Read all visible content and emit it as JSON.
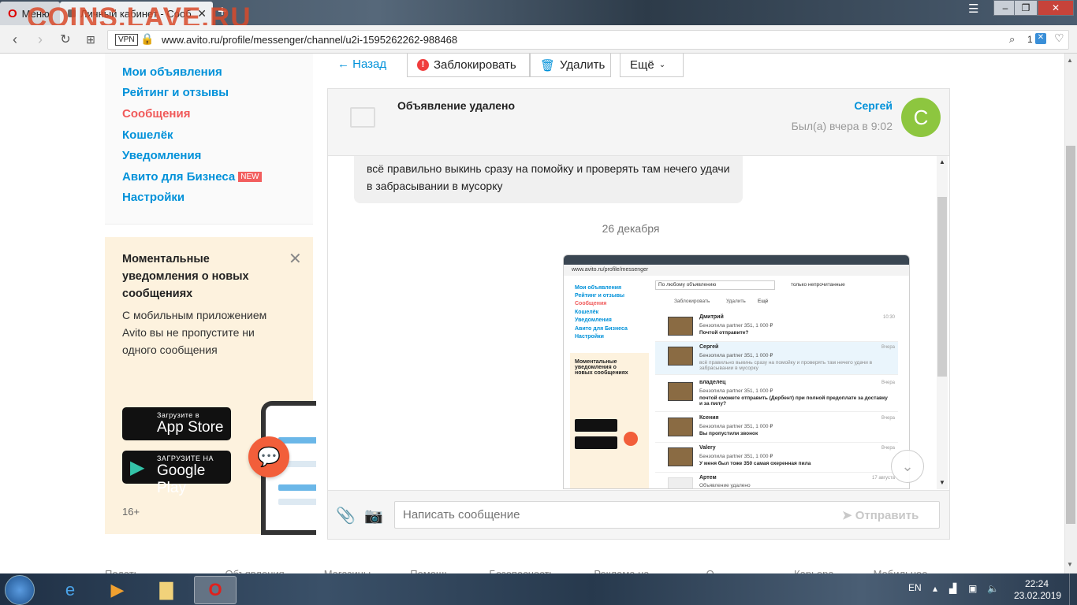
{
  "browser": {
    "tabs": [
      {
        "label": "Меню"
      },
      {
        "label": "Личный кабинет - Сооб"
      }
    ],
    "watermark": "COINS.LAVE.RU",
    "vpn": "VPN",
    "url": "www.avito.ru/profile/messenger/channel/u2i-1595262262-988468",
    "tracker_count": "1"
  },
  "sidebar": {
    "items": [
      {
        "label": "Мои объявления"
      },
      {
        "label": "Рейтинг и отзывы"
      },
      {
        "label": "Сообщения"
      },
      {
        "label": "Кошелёк"
      },
      {
        "label": "Уведомления"
      },
      {
        "label": "Авито для Бизнеса"
      },
      {
        "label": "Настройки"
      }
    ],
    "new_badge": "NEW",
    "active_color": "#f05a5a",
    "link_color": "#0091d9"
  },
  "promo": {
    "title": "Моментальные уведомления о новых сообщениях",
    "text": "С мобильным приложением Avito вы не пропустите ни одного сообщения",
    "appstore_small": "Загрузите в",
    "appstore_big": "App Store",
    "googleplay_small": "ЗАГРУЗИТЕ НА",
    "googleplay_big": "Google Play",
    "age": "16+"
  },
  "toolbar": {
    "back": "← Назад",
    "block": "Заблокировать",
    "delete": "Удалить",
    "more": "Ещё"
  },
  "chat": {
    "item_title": "Объявление удалено",
    "user_name": "Сергей",
    "avatar_letter": "С",
    "last_seen": "Был(а) вчера в 9:02",
    "message": "всё правильно выкинь сразу на помойку и проверять там нечего удачи в забрасывании в мусорку",
    "date_separator": "26 декабря",
    "input_placeholder": "Написать сообщение",
    "send": "Отправить"
  },
  "screenshot_preview": {
    "url": "www.avito.ru/profile/messenger",
    "filter": "По любому объявлению",
    "unread_only": "только непрочитанные",
    "block": "Заблокировать",
    "delete": "Удалить",
    "more": "Ещё",
    "sidebar": [
      "Мои объявления",
      "Рейтинг и отзывы",
      "Сообщения",
      "Кошелёк",
      "Уведомления",
      "Авито для Бизнеса",
      "Настройки"
    ],
    "promo": "Моментальные уведомления о новых сообщениях",
    "rows": [
      {
        "name": "Дмитрий",
        "line1": "Бензопила partner 351, 1 000 ₽",
        "line2": "Почтой отправите?",
        "time": "10:30"
      },
      {
        "name": "Сергей",
        "line1": "Бензопила partner 351, 1 000 ₽",
        "line2": "всё правильно выкинь сразу на помойку и проверять там нечего удачи в забрасывании в мусорку",
        "time": "Вчера"
      },
      {
        "name": "владелец",
        "line1": "Бензопила partner 351, 1 000 ₽",
        "line2": "почтой сможете отправить (Дербент) при полной предоплате за доставку и за пилу?",
        "time": "Вчера"
      },
      {
        "name": "Ксения",
        "line1": "Бензопила partner 351, 1 000 ₽",
        "line2": "Вы пропустили звонок",
        "time": "Вчера"
      },
      {
        "name": "Valery",
        "line1": "Бензопила partner 351, 1 000 ₽",
        "line2": "У меня был тоже 350 самая охеренная пила",
        "time": "Вчера"
      },
      {
        "name": "Артем",
        "line1": "Объявление удалено",
        "line2": "",
        "time": "17 августа"
      }
    ]
  },
  "footer": {
    "links": [
      "Подать объявление",
      "Объявления",
      "Магазины",
      "Помощь",
      "Безопасность",
      "Реклама на сайте",
      "О компании",
      "Карьера",
      "Мобильное приложение"
    ]
  },
  "taskbar": {
    "lang": "EN",
    "time": "22:24",
    "date": "23.02.2019"
  }
}
